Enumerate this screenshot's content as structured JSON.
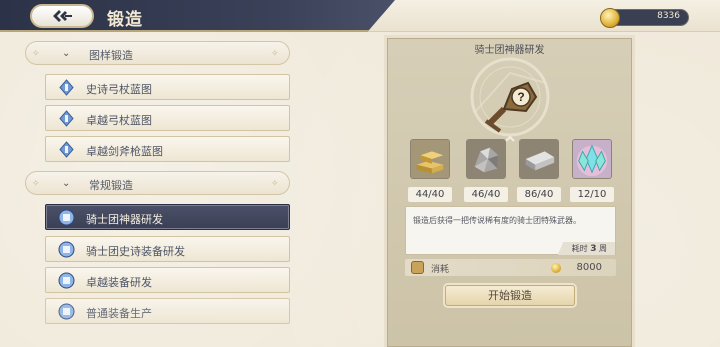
{
  "header": {
    "title": "锻造",
    "currency_value": "8336"
  },
  "sections": [
    {
      "label": "图样锻造",
      "items": [
        {
          "label": "史诗弓杖蓝图"
        },
        {
          "label": "卓越弓杖蓝图"
        },
        {
          "label": "卓越剑斧枪蓝图"
        }
      ]
    },
    {
      "label": "常规锻造",
      "items": [
        {
          "label": "骑士团神器研发",
          "active": true
        },
        {
          "label": "骑士团史诗装备研发"
        },
        {
          "label": "卓越装备研发"
        },
        {
          "label": "普通装备生产"
        }
      ]
    }
  ],
  "detail": {
    "item_name": "骑士团神器研发",
    "materials": [
      {
        "icon": "gold-bars-icon",
        "count": "44/40"
      },
      {
        "icon": "iron-ore-icon",
        "count": "46/40"
      },
      {
        "icon": "steel-ingot-icon",
        "count": "86/40"
      },
      {
        "icon": "crystal-icon",
        "count": "12/10"
      }
    ],
    "description": "锻造后获得一把传说稀有度的骑士团特殊武器。",
    "duration_label": "耗时",
    "duration_value": "3",
    "duration_unit": "周",
    "cost_label": "消耗",
    "cost_value": "8000",
    "button_label": "开始锻造"
  },
  "colors": {
    "title_bar": "#2c3247",
    "active_item": "#3a3f55",
    "panel_bg": "#d6ceb6"
  }
}
